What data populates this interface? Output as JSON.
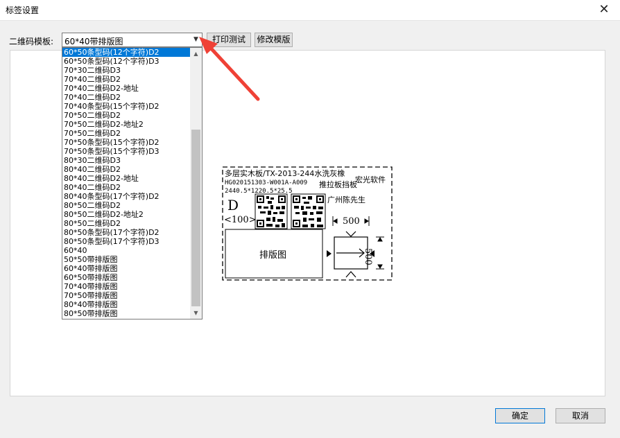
{
  "window": {
    "title": "标签设置",
    "close_glyph": "✕"
  },
  "template": {
    "label": "二维码模板:",
    "selected": "60*40带排版图",
    "options": [
      "60*50条型码(12个字符)D2",
      "60*50条型码(12个字符)D3",
      "70*30二维码D3",
      "70*40二维码D2",
      "70*40二维码D2-地址",
      "70*40二维码D2",
      "70*40条型码(15个字符)D2",
      "70*50二维码D2",
      "70*50二维码D2-地址2",
      "70*50二维码D2",
      "70*50条型码(15个字符)D2",
      "70*50条型码(15个字符)D3",
      "80*30二维码D3",
      "80*40二维码D2",
      "80*40二维码D2-地址",
      "80*40二维码D2",
      "80*40条型码(17个字符)D2",
      "80*50二维码D2",
      "80*50二维码D2-地址2",
      "80*50二维码D2",
      "80*50条型码(17个字符)D2",
      "80*50条型码(17个字符)D3",
      "60*40",
      "50*50带排版图",
      "60*40带排版图",
      "60*50带排版图",
      "70*40带排版图",
      "70*50带排版图",
      "80*40带排版图",
      "80*50带排版图"
    ],
    "highlighted_index": 0
  },
  "buttons": {
    "print_test": "打印测试",
    "edit_template": "修改模版",
    "ok": "确定",
    "cancel": "取消"
  },
  "preview": {
    "line1": "多层实木板/TX-2013-244水洗灰橡",
    "line2": "HG020151303-W001A-A009",
    "line2_suffix": "推拉板挡板",
    "line3": "2440.5*1220.5*25.5",
    "brand": "宏光软件",
    "customer": "广州陈先生",
    "grade": "D",
    "qty": "<100>",
    "layout_box": "排版图",
    "dim_width": "500",
    "dim_height": "500"
  },
  "colors": {
    "accent": "#0078d7",
    "annotation_arrow": "#ef4136"
  }
}
